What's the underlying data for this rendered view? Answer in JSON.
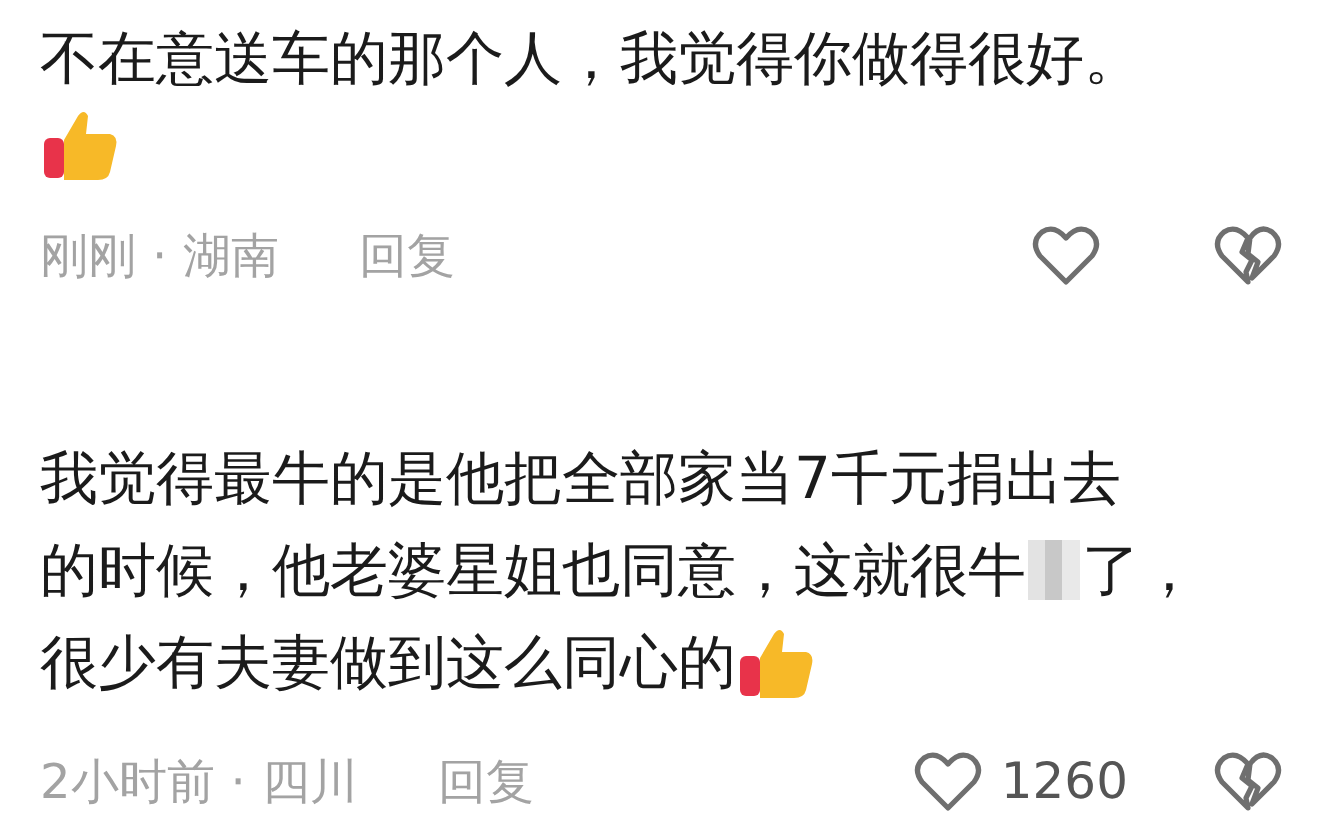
{
  "comments": [
    {
      "lines": [
        {
          "text": "不在意送车的那个人，我觉得你做得很好。"
        },
        {
          "thumb": true
        }
      ],
      "time": "刚刚",
      "separator": "·",
      "place": "湖南",
      "reply": "回复"
    },
    {
      "lines": [
        {
          "text": "我觉得最牛的是他把全部家当7千元捐出去"
        },
        {
          "text": "的时候，他老婆星姐也同意，这就很牛",
          "mosaic": true,
          "after": "了，"
        },
        {
          "text": "很少有夫妻做到这么同心的",
          "thumb": true
        }
      ],
      "time": "2小时前",
      "separator": "·",
      "place": "四川",
      "reply": "回复",
      "likes": "1260"
    }
  ]
}
